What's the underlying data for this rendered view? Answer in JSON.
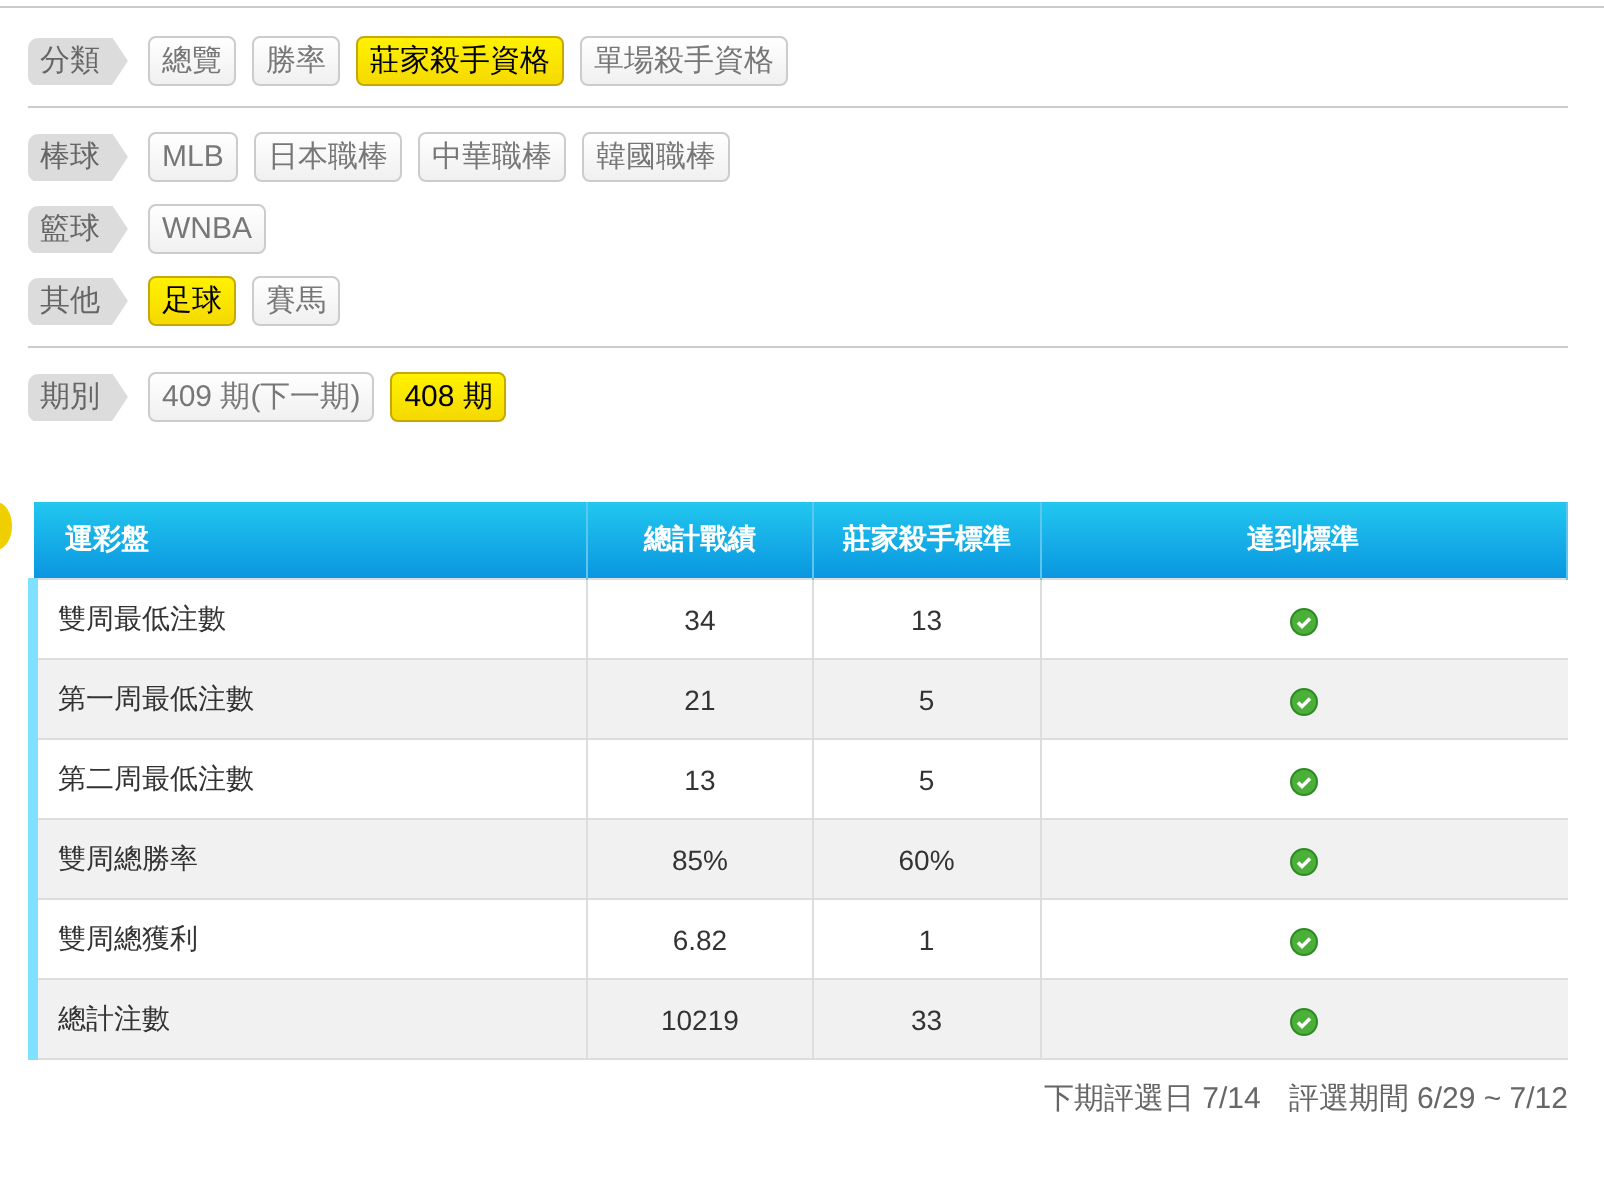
{
  "filter_sections": [
    {
      "groups": [
        {
          "label": "分類",
          "options": [
            {
              "label": "總覽",
              "selected": false
            },
            {
              "label": "勝率",
              "selected": false
            },
            {
              "label": "莊家殺手資格",
              "selected": true
            },
            {
              "label": "單場殺手資格",
              "selected": false
            }
          ]
        }
      ]
    },
    {
      "groups": [
        {
          "label": "棒球",
          "options": [
            {
              "label": "MLB",
              "selected": false
            },
            {
              "label": "日本職棒",
              "selected": false
            },
            {
              "label": "中華職棒",
              "selected": false
            },
            {
              "label": "韓國職棒",
              "selected": false
            }
          ]
        },
        {
          "label": "籃球",
          "options": [
            {
              "label": "WNBA",
              "selected": false
            }
          ]
        },
        {
          "label": "其他",
          "options": [
            {
              "label": "足球",
              "selected": true
            },
            {
              "label": "賽馬",
              "selected": false
            }
          ]
        }
      ]
    },
    {
      "groups": [
        {
          "label": "期別",
          "options": [
            {
              "label": "409 期(下一期)",
              "selected": false
            },
            {
              "label": "408 期",
              "selected": true
            }
          ]
        }
      ]
    }
  ],
  "table": {
    "columns": [
      "運彩盤",
      "總計戰績",
      "莊家殺手標準",
      "達到標準"
    ],
    "rows": [
      {
        "name": "雙周最低注數",
        "total": "34",
        "standard": "13",
        "met": true
      },
      {
        "name": "第一周最低注數",
        "total": "21",
        "standard": "5",
        "met": true
      },
      {
        "name": "第二周最低注數",
        "total": "13",
        "standard": "5",
        "met": true
      },
      {
        "name": "雙周總勝率",
        "total": "85%",
        "standard": "60%",
        "met": true
      },
      {
        "name": "雙周總獲利",
        "total": "6.82",
        "standard": "1",
        "met": true
      },
      {
        "name": "總計注數",
        "total": "10219",
        "standard": "33",
        "met": true
      }
    ]
  },
  "footer": {
    "next_date": "下期評選日 7/14",
    "period": "評選期間 6/29 ~ 7/12"
  }
}
